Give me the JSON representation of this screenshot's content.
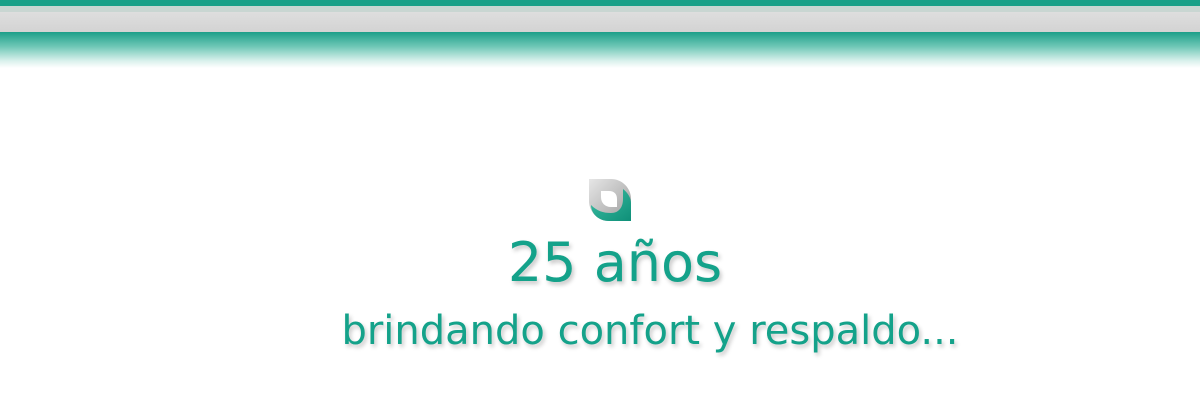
{
  "banner": {
    "headline": "25 años",
    "tagline": "brindando confort y respaldo...",
    "logo_icon": "leaf-icon"
  },
  "colors": {
    "accent": "#14a28a",
    "band_dark": "#19a088",
    "band_light": "#dedede",
    "background": "#ffffff"
  }
}
